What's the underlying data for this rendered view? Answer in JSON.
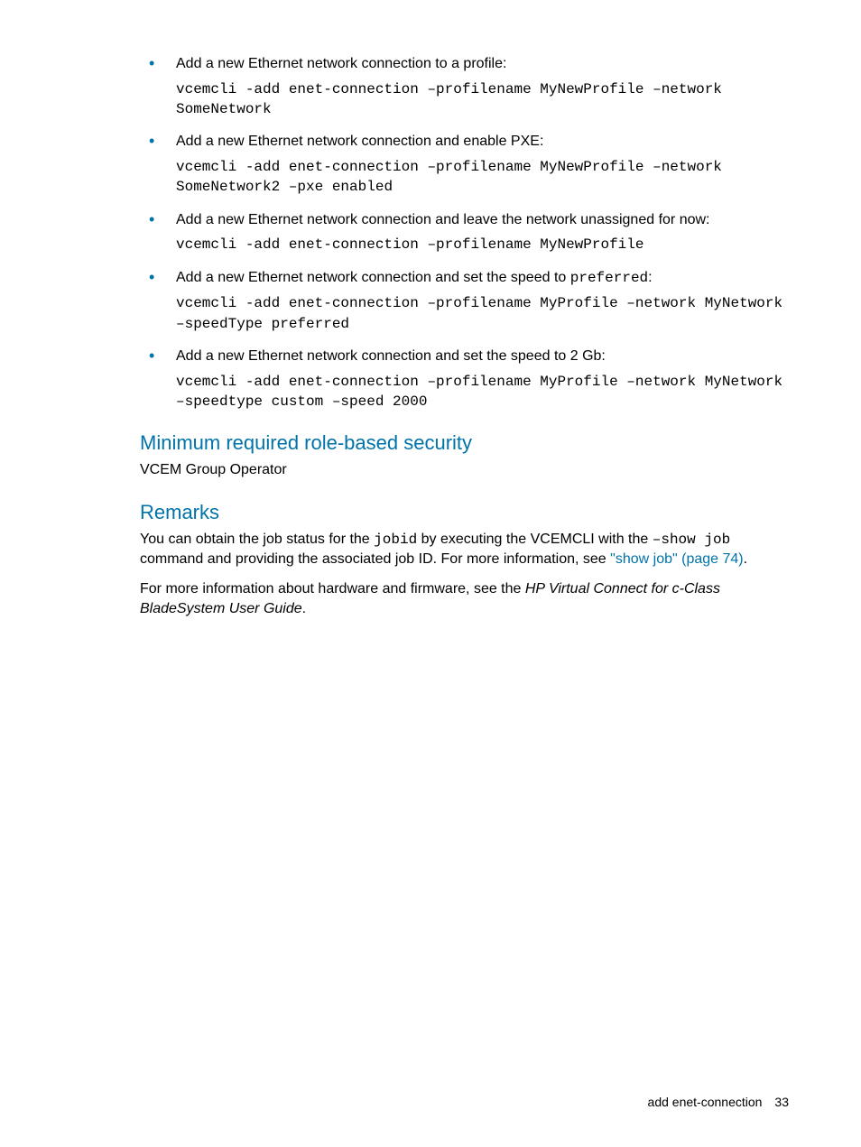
{
  "bullets": [
    {
      "desc": "Add a new Ethernet network connection to a profile:",
      "code": "vcemcli -add enet-connection –profilename MyNewProfile –network SomeNetwork"
    },
    {
      "desc": "Add a new Ethernet network connection and enable PXE:",
      "code": "vcemcli -add enet-connection –profilename MyNewProfile –network SomeNetwork2 –pxe enabled"
    },
    {
      "desc": "Add a new Ethernet network connection and leave the network unassigned for now:",
      "code": "vcemcli -add enet-connection –profilename MyNewProfile"
    },
    {
      "desc_pre": "Add a new Ethernet network connection and set the speed to ",
      "desc_code": "preferred",
      "desc_post": ":",
      "code": "vcemcli -add enet-connection –profilename MyProfile –network MyNetwork –speedType preferred"
    },
    {
      "desc": "Add a new Ethernet network connection and set the speed to 2 Gb:",
      "code": "vcemcli -add enet-connection –profilename MyProfile –network MyNetwork –speedtype custom –speed 2000"
    }
  ],
  "security_heading": "Minimum required role-based security",
  "security_text": "VCEM Group Operator",
  "remarks_heading": "Remarks",
  "remarks_p1_a": "You can obtain the job status for the ",
  "remarks_p1_code1": "jobid",
  "remarks_p1_b": " by executing the VCEMCLI with the ",
  "remarks_p1_code2": "–show job",
  "remarks_p1_c": " command and providing the associated job ID. For more information, see ",
  "remarks_p1_link": "\"show job\" (page 74)",
  "remarks_p1_d": ".",
  "remarks_p2_a": "For more information about hardware and firmware, see the ",
  "remarks_p2_italic": "HP Virtual Connect for c-Class BladeSystem User Guide",
  "remarks_p2_b": ".",
  "footer_title": "add enet-connection",
  "footer_page": "33"
}
